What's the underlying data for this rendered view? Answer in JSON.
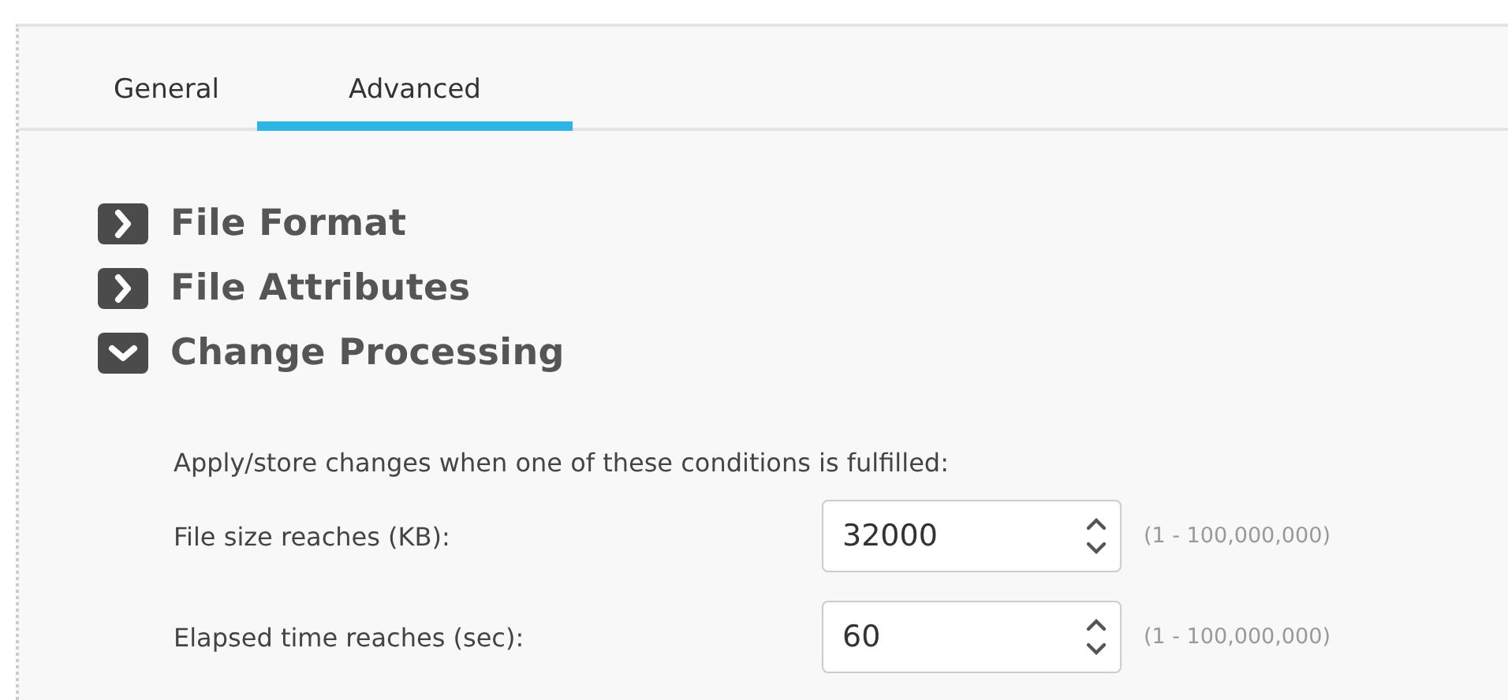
{
  "tabs": [
    {
      "label": "General",
      "selected": false
    },
    {
      "label": "Advanced",
      "selected": true
    }
  ],
  "sections": [
    {
      "title": "File Format",
      "expanded": false
    },
    {
      "title": "File Attributes",
      "expanded": false
    },
    {
      "title": "Change Processing",
      "expanded": true
    }
  ],
  "change_processing": {
    "intro": "Apply/store changes when one of these conditions is fulfilled:",
    "fields": [
      {
        "label": "File size reaches (KB):",
        "value": "32000",
        "range": "(1 - 100,000,000)"
      },
      {
        "label": "Elapsed time reaches (sec):",
        "value": "60",
        "range": "(1 - 100,000,000)"
      }
    ]
  }
}
